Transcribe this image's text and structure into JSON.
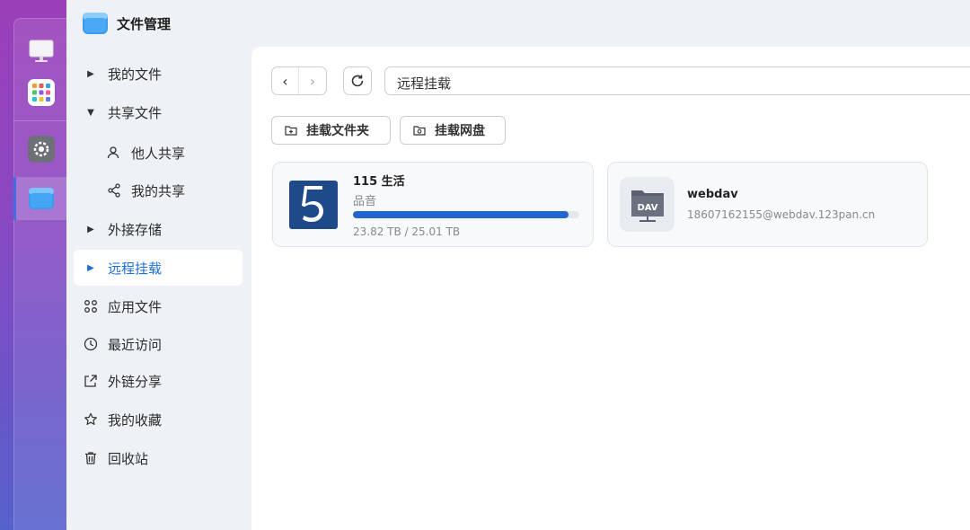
{
  "app": {
    "title": "文件管理",
    "icon": "folder-app-icon"
  },
  "dock": {
    "items": [
      {
        "name": "monitor-icon"
      },
      {
        "name": "apps-grid-icon"
      },
      {
        "name": "settings-icon"
      },
      {
        "name": "file-manager-icon",
        "active": true
      }
    ]
  },
  "sidebar": {
    "items": [
      {
        "label": "我的文件",
        "icon": "caret-right"
      },
      {
        "label": "共享文件",
        "icon": "caret-down"
      },
      {
        "label": "他人共享",
        "icon": "user-icon"
      },
      {
        "label": "我的共享",
        "icon": "share-icon"
      },
      {
        "label": "外接存储",
        "icon": "caret-right"
      },
      {
        "label": "远程挂载",
        "icon": "caret-right",
        "active": true
      },
      {
        "label": "应用文件",
        "icon": "command-icon"
      },
      {
        "label": "最近访问",
        "icon": "clock-icon"
      },
      {
        "label": "外链分享",
        "icon": "export-icon"
      },
      {
        "label": "我的收藏",
        "icon": "star-icon"
      },
      {
        "label": "回收站",
        "icon": "trash-icon"
      }
    ]
  },
  "toolbar": {
    "path": "远程挂载",
    "mount_folder_label": "挂载文件夹",
    "mount_disk_label": "挂载网盘"
  },
  "mounts": [
    {
      "title": "115 生活",
      "subtitle": "品音",
      "usage": "23.82 TB / 25.01 TB",
      "used_fraction": 0.952,
      "icon": "115-logo-icon"
    },
    {
      "title": "webdav",
      "subtitle": "18607162155@webdav.123pan.cn",
      "icon": "dav-folder-icon",
      "icon_text": "DAV"
    }
  ],
  "colors": {
    "accent": "#1e6fd9",
    "progress": "#2166d2",
    "logo_bg": "#1f4a8a"
  }
}
